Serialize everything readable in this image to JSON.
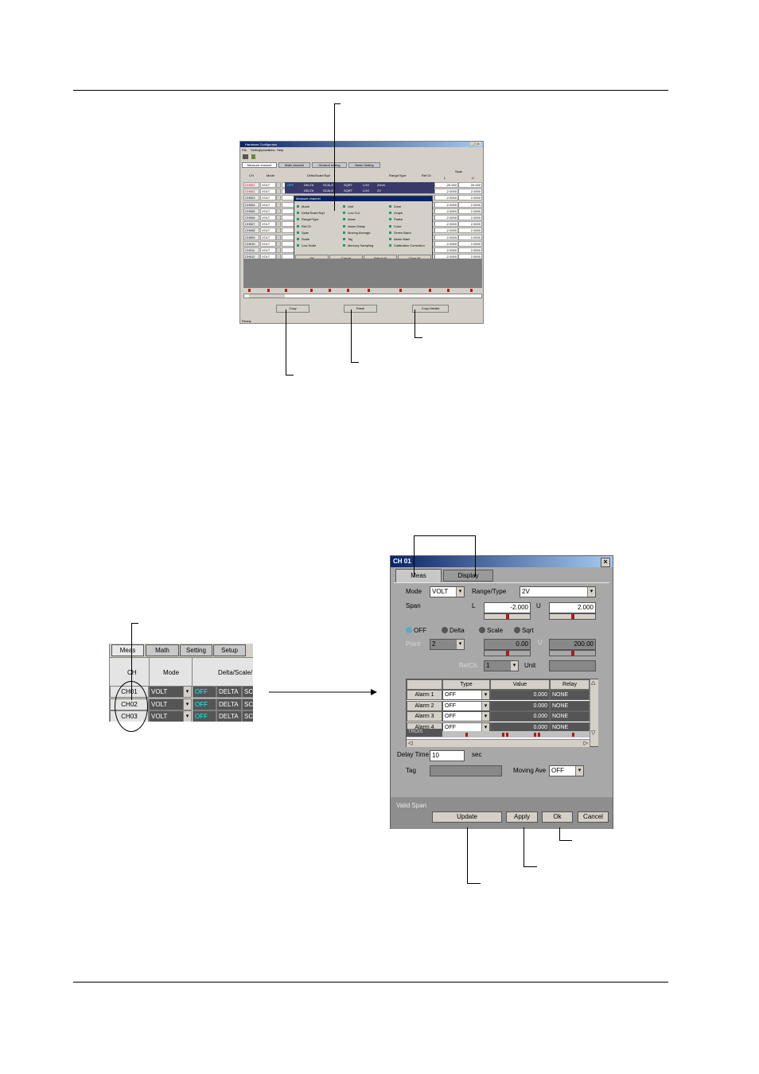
{
  "top_window": {
    "title": "Hardware Configurator",
    "menu": [
      "File",
      "Setting",
      "System",
      "View",
      "Help"
    ],
    "tabs": [
      "Measure channel",
      "Math channel",
      "General setting",
      "Basic Setting"
    ],
    "headers": {
      "ch": "CH",
      "mode": "Mode",
      "delta": "Delta/Scale/Sqrt",
      "range": "Range/Type",
      "refch": "Ref.Ch",
      "span": "Span",
      "l": "L",
      "u": "U"
    },
    "rows": [
      {
        "ch": "CH001",
        "mode": "VOLT",
        "l": "-20.000",
        "u": "20.000"
      },
      {
        "ch": "CH002",
        "mode": "VOLT",
        "l": "-2.0000",
        "u": "2.0000"
      },
      {
        "ch": "CH003",
        "mode": "VOLT",
        "l": "-2.0000",
        "u": "2.0000"
      },
      {
        "ch": "CH004",
        "mode": "VOLT",
        "l": "-2.0000",
        "u": "2.0000"
      },
      {
        "ch": "CH005",
        "mode": "VOLT",
        "l": "-2.0000",
        "u": "2.0000"
      },
      {
        "ch": "CH006",
        "mode": "VOLT",
        "l": "-2.0000",
        "u": "2.0000"
      },
      {
        "ch": "CH007",
        "mode": "VOLT",
        "l": "-2.0000",
        "u": "2.0000"
      },
      {
        "ch": "CH008",
        "mode": "VOLT",
        "l": "-2.0000",
        "u": "2.0000"
      },
      {
        "ch": "CH009",
        "mode": "VOLT",
        "l": "-2.0000",
        "u": "2.0000"
      },
      {
        "ch": "CH010",
        "mode": "VOLT",
        "l": "-2.0000",
        "u": "2.0000"
      },
      {
        "ch": "CH011",
        "mode": "VOLT",
        "l": "-2.0000",
        "u": "2.0000"
      },
      {
        "ch": "CH012",
        "mode": "VOLT",
        "l": "-2.0000",
        "u": "2.0000"
      }
    ],
    "row1_extra": {
      "off": "OFF",
      "delta": "DELTA",
      "scale": "SCALE",
      "sqrt": "SQRT",
      "log": "LOG",
      "range1": "20mV",
      "range2": "2V"
    },
    "popup": {
      "title": "Measure channel",
      "items": [
        "Mode",
        "Unit",
        "Zone",
        "Delta/Scale/Sqrt",
        "Low Cut",
        "Graph",
        "Range/Type",
        "Alarm",
        "Partial",
        "Ref.Ch",
        "Alarm Delay",
        "Color",
        "Span",
        "Moving Average",
        "Green Band",
        "Scale",
        "Tag",
        "Alarm Mark",
        "Low Scale",
        "Memory Sampling",
        "Calibration Correction"
      ],
      "buttons": [
        "OK",
        "Cancel",
        "Select All",
        "Clear All"
      ]
    },
    "bottom_buttons": [
      "Copy",
      "Paste",
      "Copy Details"
    ],
    "status": "Ready"
  },
  "crop": {
    "tabs": [
      "Meas",
      "Math",
      "Setting",
      "Setup"
    ],
    "headers": {
      "ch": "CH",
      "mode": "Mode",
      "delta": "Delta/Scale/"
    },
    "rows": [
      {
        "ch": "CH01",
        "mode": "VOLT",
        "off": "OFF",
        "delta": "DELTA",
        "sc": "SC"
      },
      {
        "ch": "CH02",
        "mode": "VOLT",
        "off": "OFF",
        "delta": "DELTA",
        "sc": "SC"
      },
      {
        "ch": "CH03",
        "mode": "VOLT",
        "off": "OFF",
        "delta": "DELTA",
        "sc": "SC"
      }
    ]
  },
  "dialog": {
    "title": "CH 01",
    "close": "×",
    "tabs": [
      "Meas",
      "Display"
    ],
    "mode_label": "Mode",
    "mode_value": "VOLT",
    "range_label": "Range/Type",
    "range_value": "2V",
    "span_label": "Span",
    "span_l_label": "L",
    "span_l_value": "-2.000",
    "span_u_label": "U",
    "span_u_value": "2.000",
    "radios": [
      "OFF",
      "Delta",
      "Scale",
      "Sqrt"
    ],
    "point_label": "Point",
    "point_value": "2",
    "scale_l_value": "0.00",
    "scale_u_label": "U",
    "scale_u_value": "200.00",
    "refch_label": "RefCh",
    "refch_value": "1",
    "unit_label": "Unit",
    "alarm_headers": [
      "Type",
      "Value",
      "Relay"
    ],
    "alarms": [
      {
        "name": "Alarm 1",
        "type": "OFF",
        "value": "0.000",
        "relay": "NONE"
      },
      {
        "name": "Alarm 2",
        "type": "OFF",
        "value": "0.000",
        "relay": "NONE"
      },
      {
        "name": "Alarm 3",
        "type": "OFF",
        "value": "0.000",
        "relay": "NONE"
      },
      {
        "name": "Alarm 4",
        "type": "OFF",
        "value": "0.000",
        "relay": "NONE"
      }
    ],
    "tail_label": "TROIS",
    "delay_label": "Delay Time",
    "delay_value": "10",
    "delay_unit": "sec",
    "tag_label": "Tag",
    "moving_label": "Moving Ave",
    "moving_value": "OFF",
    "status": "Valid Span",
    "buttons": [
      "Update",
      "Apply",
      "Ok",
      "Cancel"
    ]
  },
  "colors": {
    "title_bar": "#0a246a",
    "radio_on": "#5fa9c8",
    "off_text": "#00ffff",
    "marker_red": "#b01818"
  }
}
